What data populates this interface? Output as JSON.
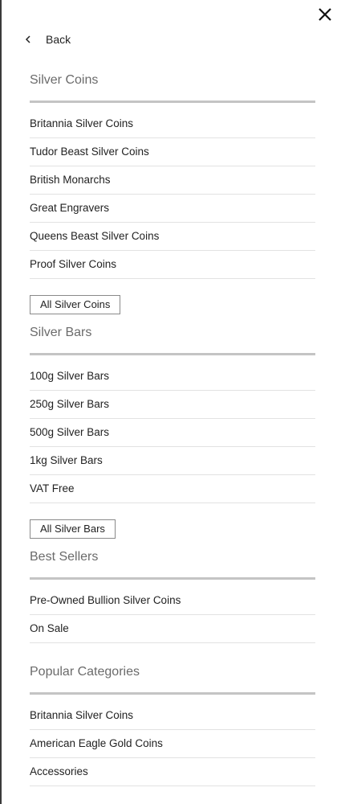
{
  "menu": {
    "back_label": "Back",
    "sections": [
      {
        "title": "Silver Coins",
        "items": [
          "Britannia Silver Coins",
          "Tudor Beast Silver Coins",
          "British Monarchs",
          "Great Engravers",
          "Queens Beast Silver Coins",
          "Proof Silver Coins"
        ],
        "all_label": "All Silver Coins"
      },
      {
        "title": "Silver Bars",
        "items": [
          "100g Silver Bars",
          "250g Silver Bars",
          "500g Silver Bars",
          "1kg Silver Bars",
          "VAT Free"
        ],
        "all_label": "All Silver Bars"
      },
      {
        "title": "Best Sellers",
        "items": [
          "Pre-Owned Bullion Silver Coins",
          "On Sale"
        ]
      },
      {
        "title": "Popular Categories",
        "items": [
          "Britannia Silver Coins",
          "American Eagle Gold Coins",
          "Accessories"
        ]
      }
    ]
  },
  "icons": {
    "close": "close-icon",
    "back": "chevron-left-icon"
  }
}
